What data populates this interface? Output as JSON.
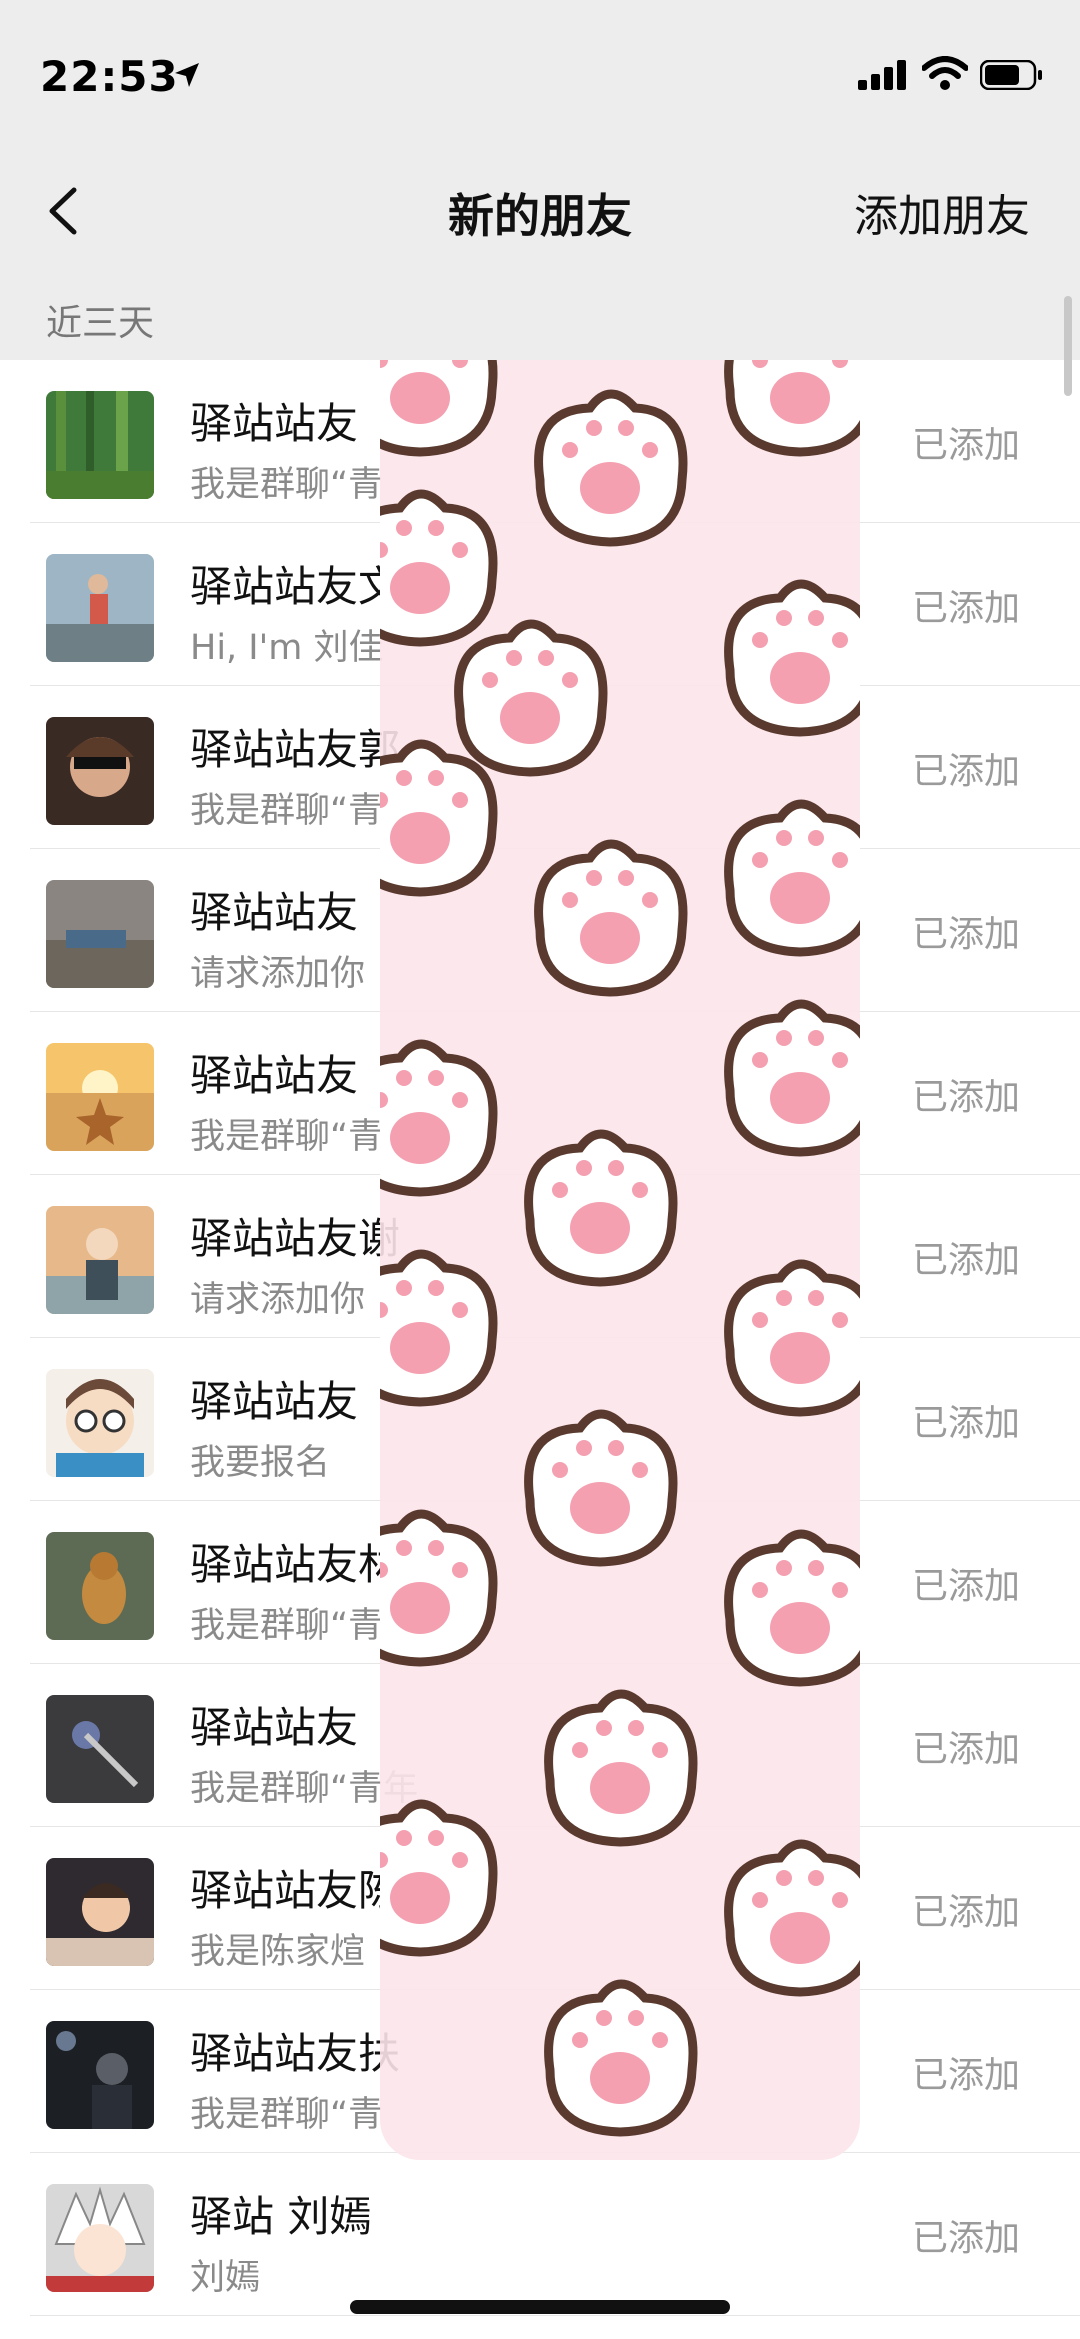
{
  "status_bar": {
    "time": "22:53"
  },
  "nav": {
    "title": "新的朋友",
    "add_friend": "添加朋友"
  },
  "section": {
    "label": "近三天"
  },
  "rows": [
    {
      "name": "驿站站友",
      "message": "我是群聊“青",
      "status": "已添加",
      "avatar": "forest"
    },
    {
      "name": "驿站站友文",
      "message": "Hi, I'm 刘佳",
      "status": "已添加",
      "avatar": "runner"
    },
    {
      "name": "驿站站友郭",
      "message": "我是群聊“青",
      "status": "已添加",
      "avatar": "sunglasses-man"
    },
    {
      "name": "驿站站友",
      "message": "请求添加你",
      "status": "已添加",
      "avatar": "floor-object"
    },
    {
      "name": "驿站站友",
      "message": "我是群聊“青",
      "status": "已添加",
      "avatar": "beach-starfish"
    },
    {
      "name": "驿站站友谢",
      "message": "请求添加你",
      "status": "已添加",
      "avatar": "anime-boy"
    },
    {
      "name": "驿站站友",
      "message": "我要报名",
      "status": "已添加",
      "avatar": "cartoon-glasses"
    },
    {
      "name": "驿站站友林",
      "message": "我是群聊“青年",
      "status": "已添加",
      "avatar": "dog"
    },
    {
      "name": "驿站站友",
      "message": "我是群聊“青年",
      "status": "已添加",
      "avatar": "keyring"
    },
    {
      "name": "驿站站友陈",
      "message": "我是陈家煊",
      "status": "已添加",
      "avatar": "child"
    },
    {
      "name": "驿站站友扶",
      "message": "我是群聊“青",
      "status": "已添加",
      "avatar": "dark-portrait"
    },
    {
      "name": "驿站 刘嫣",
      "message": "刘嫣",
      "status": "已添加",
      "avatar": "white-hair-anime"
    }
  ],
  "colors": {
    "background": "#ededed",
    "paw_pink": "#f4a0b0",
    "paw_outline": "#5a3a2e"
  }
}
